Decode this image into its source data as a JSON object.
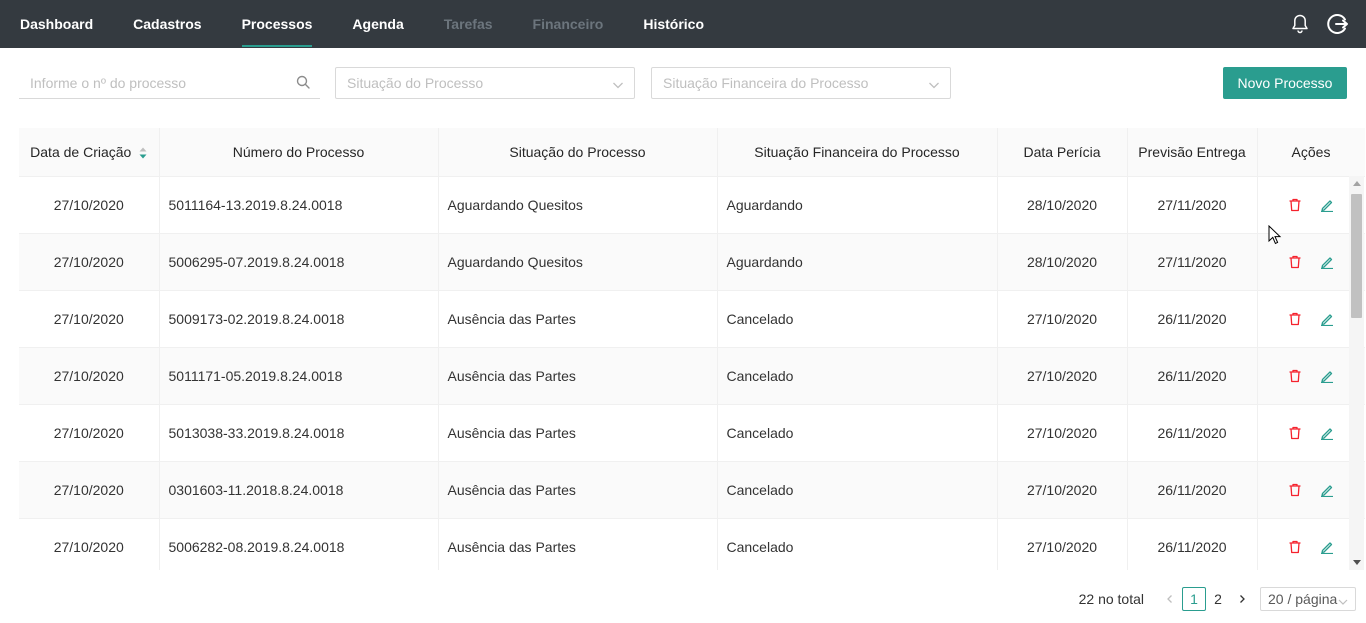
{
  "nav": {
    "items": [
      {
        "label": "Dashboard",
        "state": "normal"
      },
      {
        "label": "Cadastros",
        "state": "normal"
      },
      {
        "label": "Processos",
        "state": "active"
      },
      {
        "label": "Agenda",
        "state": "normal"
      },
      {
        "label": "Tarefas",
        "state": "disabled"
      },
      {
        "label": "Financeiro",
        "state": "disabled"
      },
      {
        "label": "Histórico",
        "state": "normal"
      }
    ],
    "icons": [
      "bell-icon",
      "logout-icon"
    ]
  },
  "filters": {
    "search_placeholder": "Informe o nº do processo",
    "situacao_placeholder": "Situação do Processo",
    "financeira_placeholder": "Situação Financeira do Processo",
    "new_button": "Novo Processo"
  },
  "table": {
    "columns": [
      "Data de Criação",
      "Número do Processo",
      "Situação do Processo",
      "Situação Financeira do Processo",
      "Data Perícia",
      "Previsão Entrega",
      "Ações"
    ],
    "rows": [
      [
        "27/10/2020",
        "5011164-13.2019.8.24.0018",
        "Aguardando Quesitos",
        "Aguardando",
        "28/10/2020",
        "27/11/2020"
      ],
      [
        "27/10/2020",
        "5006295-07.2019.8.24.0018",
        "Aguardando Quesitos",
        "Aguardando",
        "28/10/2020",
        "27/11/2020"
      ],
      [
        "27/10/2020",
        "5009173-02.2019.8.24.0018",
        "Ausência das Partes",
        "Cancelado",
        "27/10/2020",
        "26/11/2020"
      ],
      [
        "27/10/2020",
        "5011171-05.2019.8.24.0018",
        "Ausência das Partes",
        "Cancelado",
        "27/10/2020",
        "26/11/2020"
      ],
      [
        "27/10/2020",
        "5013038-33.2019.8.24.0018",
        "Ausência das Partes",
        "Cancelado",
        "27/10/2020",
        "26/11/2020"
      ],
      [
        "27/10/2020",
        "0301603-11.2018.8.24.0018",
        "Ausência das Partes",
        "Cancelado",
        "27/10/2020",
        "26/11/2020"
      ],
      [
        "27/10/2020",
        "5006282-08.2019.8.24.0018",
        "Ausência das Partes",
        "Cancelado",
        "27/10/2020",
        "26/11/2020"
      ]
    ],
    "row_actions": [
      "delete-icon",
      "edit-icon"
    ]
  },
  "pagination": {
    "total": "22 no total",
    "pages": [
      "1",
      "2"
    ],
    "current": "1",
    "page_size": "20 / página"
  },
  "colors": {
    "navbar": "#343a40",
    "accent": "#2a9d8f",
    "delete": "#f5222d"
  }
}
